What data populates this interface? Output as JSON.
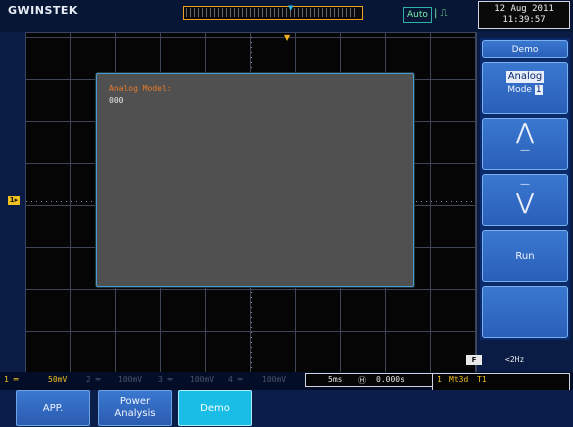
{
  "brand": "GWINSTEK",
  "datetime": {
    "line1": "12 Aug 2011",
    "line2": "11:39:57"
  },
  "trigger_mode": "Auto",
  "trigger_edge": "|  ⎍",
  "dialog": {
    "title": "Analog Model:",
    "value": "000"
  },
  "side_menu": {
    "title": "Demo",
    "analog_mode": {
      "label_top": "Analog",
      "label_bottom": "Mode",
      "value": "1"
    },
    "up_arrow": "⋀",
    "down_arrow": "⋁",
    "run": "Run"
  },
  "status": {
    "ch1": "50mV",
    "ch2": "100mV",
    "ch3": "100mV",
    "ch4": "100mV",
    "timebase": "5ms",
    "position": "0.000s",
    "freq": "<2Hz",
    "trig": "Mt3d",
    "trig_source": "T1"
  },
  "bottom_menu": {
    "app": "APP.",
    "power_line1": "Power",
    "power_line2": "Analysis",
    "demo": "Demo"
  },
  "colors": {
    "accent": "#19bde6",
    "ch1": "#f0c020",
    "menu": "#3a78d0"
  }
}
